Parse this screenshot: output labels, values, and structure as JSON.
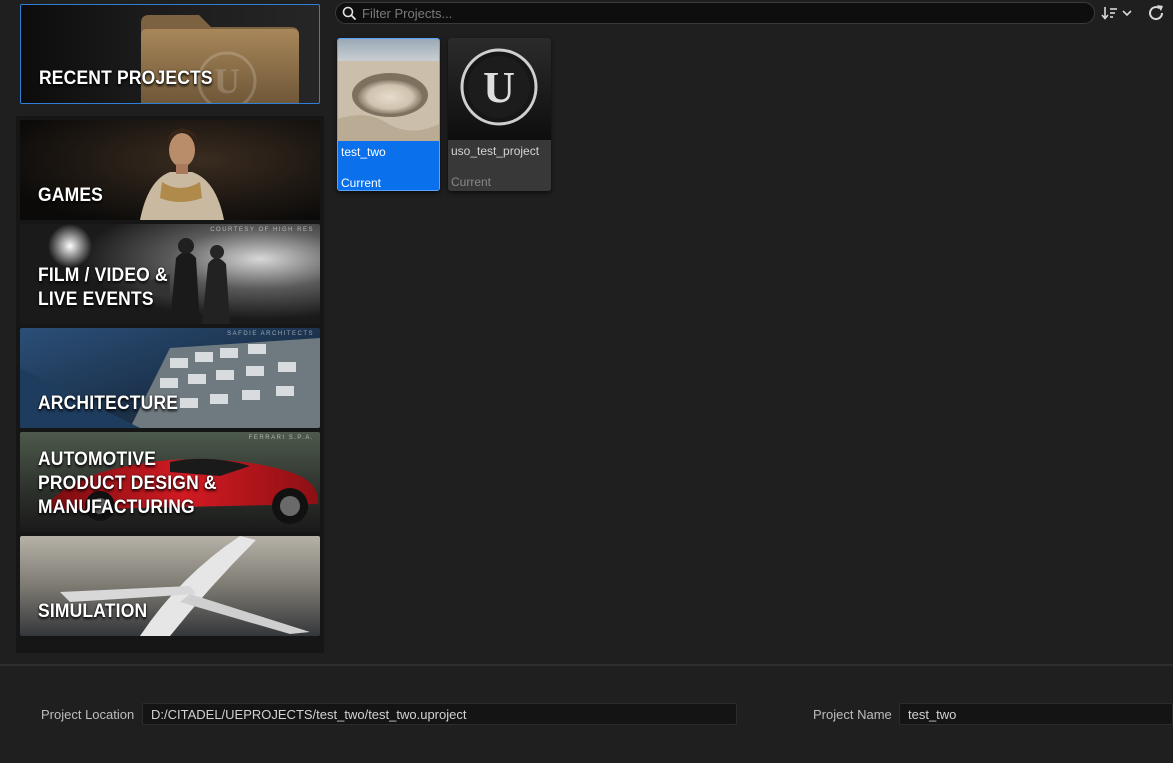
{
  "categories": {
    "recent": {
      "label": "RECENT PROJECTS"
    },
    "games": {
      "label": "GAMES"
    },
    "film": {
      "label": "FILM / VIDEO &\nLIVE EVENTS",
      "credit": "COURTESY OF HIGH RES"
    },
    "architecture": {
      "label": "ARCHITECTURE",
      "credit": "SAFDIE ARCHITECTS"
    },
    "automotive": {
      "label": "AUTOMOTIVE\nPRODUCT DESIGN &\nMANUFACTURING",
      "credit": "FERRARI S.P.A."
    },
    "simulation": {
      "label": "SIMULATION"
    }
  },
  "search": {
    "placeholder": "Filter Projects...",
    "value": ""
  },
  "toolbar": {
    "sort_icon": "sort-icon",
    "refresh_icon": "refresh-icon"
  },
  "projects": [
    {
      "name": "test_two",
      "status": "Current",
      "selected": true
    },
    {
      "name": "uso_test_project",
      "status": "Current",
      "selected": false
    }
  ],
  "footer": {
    "location_label": "Project Location",
    "location_value": "D:/CITADEL/UEPROJECTS/test_two/test_two.uproject",
    "name_label": "Project Name",
    "name_value": "test_two"
  },
  "colors": {
    "accent": "#0a70ec",
    "selection_border": "#2f7fd8",
    "background": "#1f1f1f"
  }
}
